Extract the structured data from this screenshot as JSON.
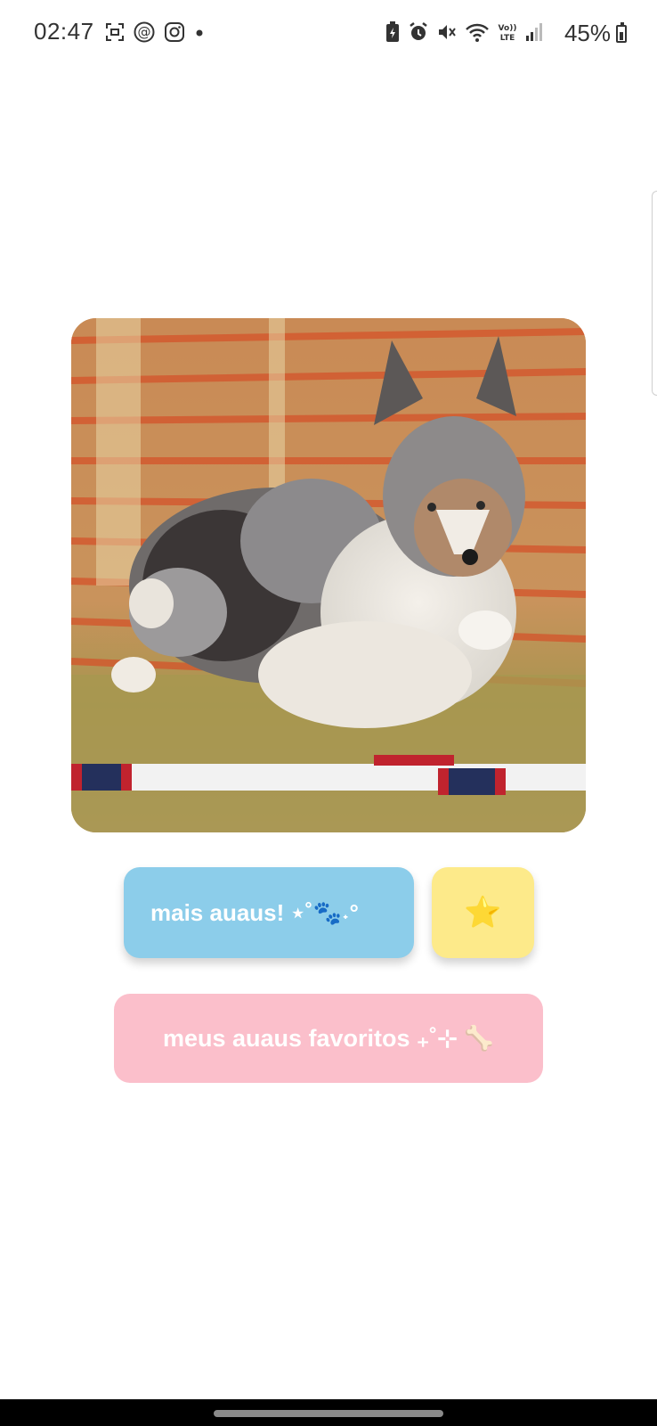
{
  "status_bar": {
    "time": "02:47",
    "battery": "45%",
    "left_icons": [
      "screenshot-icon",
      "threads-icon",
      "instagram-icon",
      "dot-icon"
    ],
    "right_icons": [
      "battery-saver-icon",
      "alarm-icon",
      "mute-icon",
      "wifi-icon",
      "volte-icon",
      "signal-icon"
    ]
  },
  "main": {
    "photo_alt": "shetland sheepdog jumping",
    "buttons": {
      "more_label": "mais auaus! ⋆˚🐾˖°",
      "favorite_icon": "⭐",
      "favorites_label": "meus auaus favoritos ₊˚⊹ 🦴"
    }
  },
  "colors": {
    "more_button": "#8ccdea",
    "favorite_button": "#fdea8a",
    "favorites_button": "#fbbfcb"
  }
}
